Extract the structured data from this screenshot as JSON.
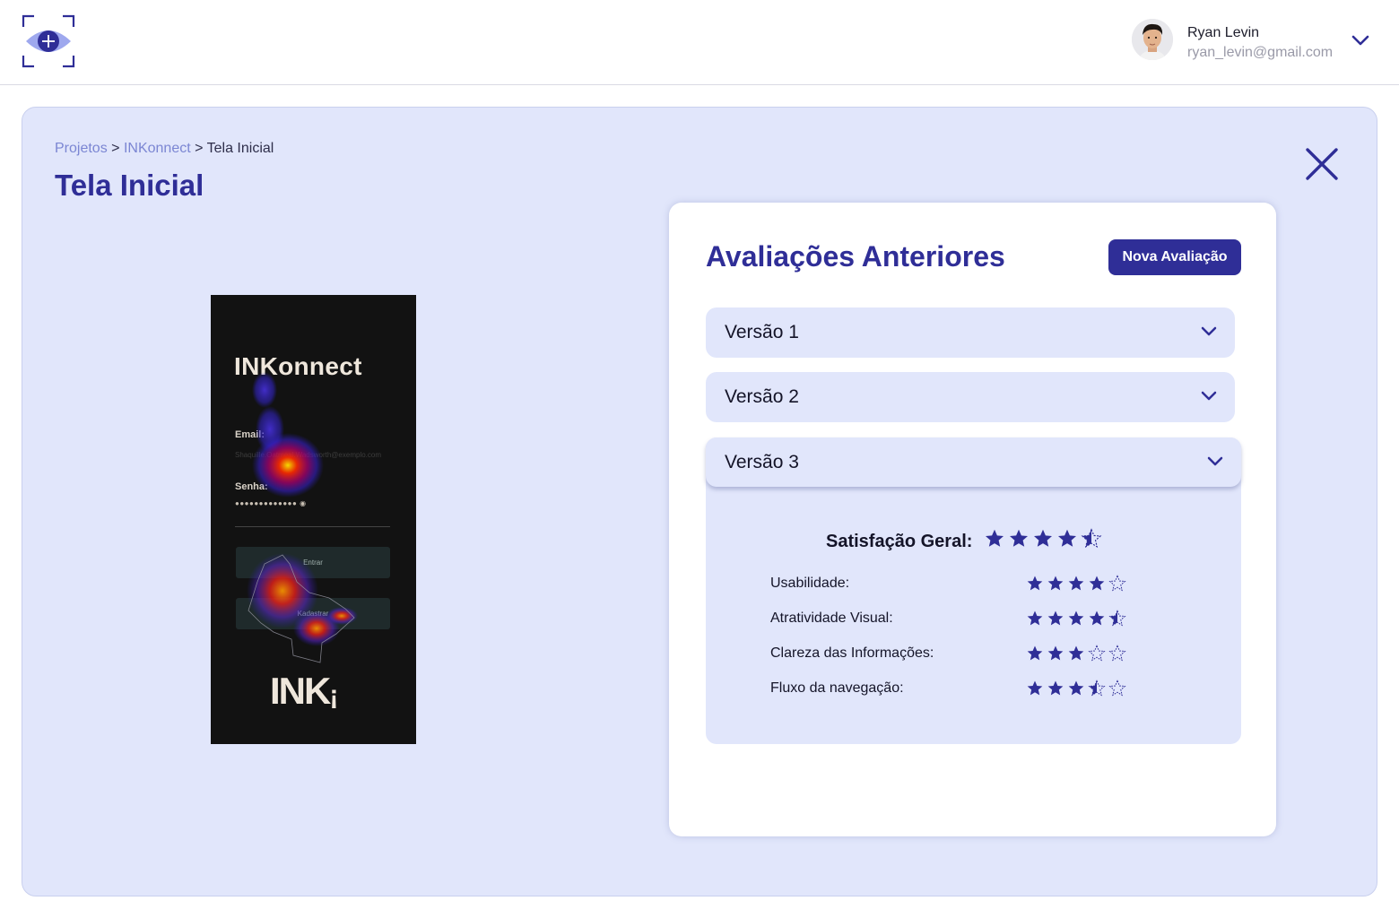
{
  "header": {
    "logo_icon": "eye-scan-icon",
    "user": {
      "name": "Ryan Levin",
      "email": "ryan_levin@gmail.com"
    }
  },
  "breadcrumb": {
    "items": [
      "Projetos",
      "INKonnect",
      "Tela Inicial"
    ],
    "separator": ">"
  },
  "page": {
    "title": "Tela Inicial"
  },
  "screen_preview": {
    "app_title": "INKonnect",
    "email_label": "Email:",
    "email_value": "Shaquille.Oatmeal.Wadsworth@exemplo.com",
    "password_label": "Senha:",
    "password_value": "●●●●●●●●●●●●●",
    "login_button": "Entrar",
    "signup_button": "Kadastrar",
    "brand": "INK"
  },
  "evaluations": {
    "title": "Avaliações Anteriores",
    "new_button": "Nova Avaliação",
    "versions": [
      {
        "label": "Versão 1",
        "expanded": false
      },
      {
        "label": "Versão 2",
        "expanded": false
      },
      {
        "label": "Versão 3",
        "expanded": true
      }
    ],
    "details": {
      "overall_label": "Satisfação Geral:",
      "overall_rating": 4.5,
      "criteria": [
        {
          "label": "Usabilidade:",
          "rating": 4
        },
        {
          "label": "Atratividade Visual:",
          "rating": 4.5
        },
        {
          "label": "Clareza das Informações:",
          "rating": 3
        },
        {
          "label": "Fluxo da navegação:",
          "rating": 3.5
        }
      ],
      "max_rating": 5
    }
  },
  "colors": {
    "primary": "#2f2e97",
    "panel_bg": "#e1e6fb",
    "link": "#7b86d3",
    "star": "#2f2e97"
  }
}
